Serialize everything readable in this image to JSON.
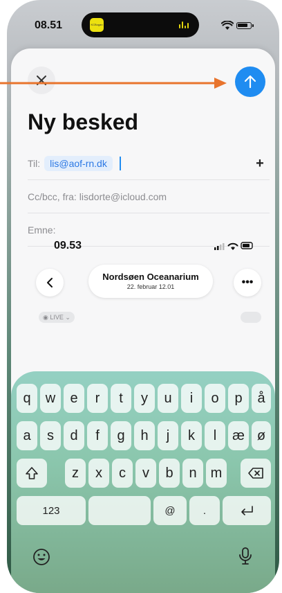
{
  "status_bar": {
    "time": "08.51",
    "island_app_label": "KCBogan"
  },
  "compose": {
    "title": "Ny besked",
    "to_label": "Til:",
    "to_value": "lis@aof-rn.dk",
    "cc_label": "Cc/bcc, fra:",
    "cc_value": "lisdorte@icloud.com",
    "subject_label": "Emne:",
    "add_icon": "+"
  },
  "embedded_screenshot": {
    "time": "09.53",
    "title": "Nordsøen Oceanarium",
    "date": "22. februar 12.01",
    "more_icon": "•••",
    "live_badge": "◉ LIVE ⌄"
  },
  "keyboard": {
    "row1": [
      "q",
      "w",
      "e",
      "r",
      "t",
      "y",
      "u",
      "i",
      "o",
      "p",
      "å"
    ],
    "row2": [
      "a",
      "s",
      "d",
      "f",
      "g",
      "h",
      "j",
      "k",
      "l",
      "æ",
      "ø"
    ],
    "row3": [
      "z",
      "x",
      "c",
      "v",
      "b",
      "n",
      "m"
    ],
    "numbers_key": "123",
    "at_key": "@",
    "dot_key": "."
  },
  "annotation_color": "#e8742d",
  "accent_color": "#1f8cf1"
}
